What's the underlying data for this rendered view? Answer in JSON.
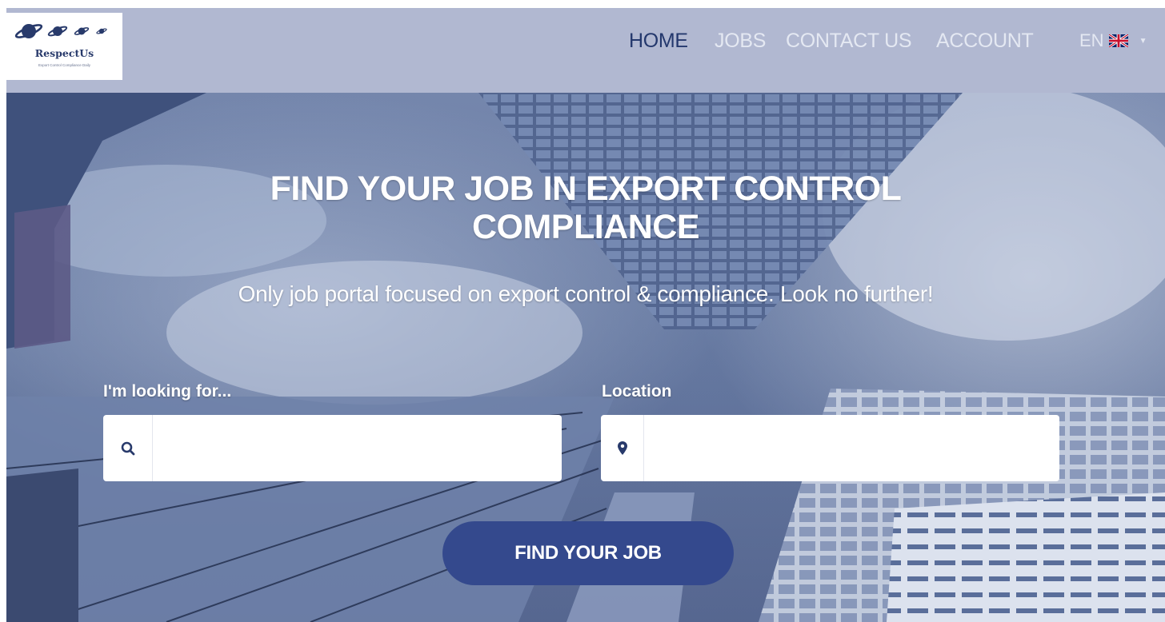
{
  "brand": {
    "name": "RespectUs",
    "tagline": "Export Control Compliance Daily",
    "color": "#283a6b"
  },
  "nav": {
    "items": [
      {
        "label": "HOME",
        "active": true
      },
      {
        "label": "JOBS",
        "active": false
      },
      {
        "label": "CONTACT US",
        "active": false
      },
      {
        "label": "ACCOUNT",
        "active": false
      }
    ],
    "language": {
      "code": "EN",
      "flag_icon": "uk-flag-icon"
    }
  },
  "hero": {
    "title_line1": "FIND YOUR JOB IN EXPORT CONTROL",
    "title_line2": "COMPLIANCE",
    "subtitle": "Only job portal focused on export control & compliance. Look no further!"
  },
  "search": {
    "keyword_label": "I'm looking for...",
    "keyword_icon": "search-icon",
    "keyword_value": "",
    "location_label": "Location",
    "location_icon": "map-pin-icon",
    "location_value": "",
    "button_label": "FIND YOUR JOB"
  },
  "colors": {
    "header_bg": "#b1b8d1",
    "nav_active": "#24386d",
    "nav_inactive": "#e4e8f2",
    "button_bg": "#34498d"
  }
}
